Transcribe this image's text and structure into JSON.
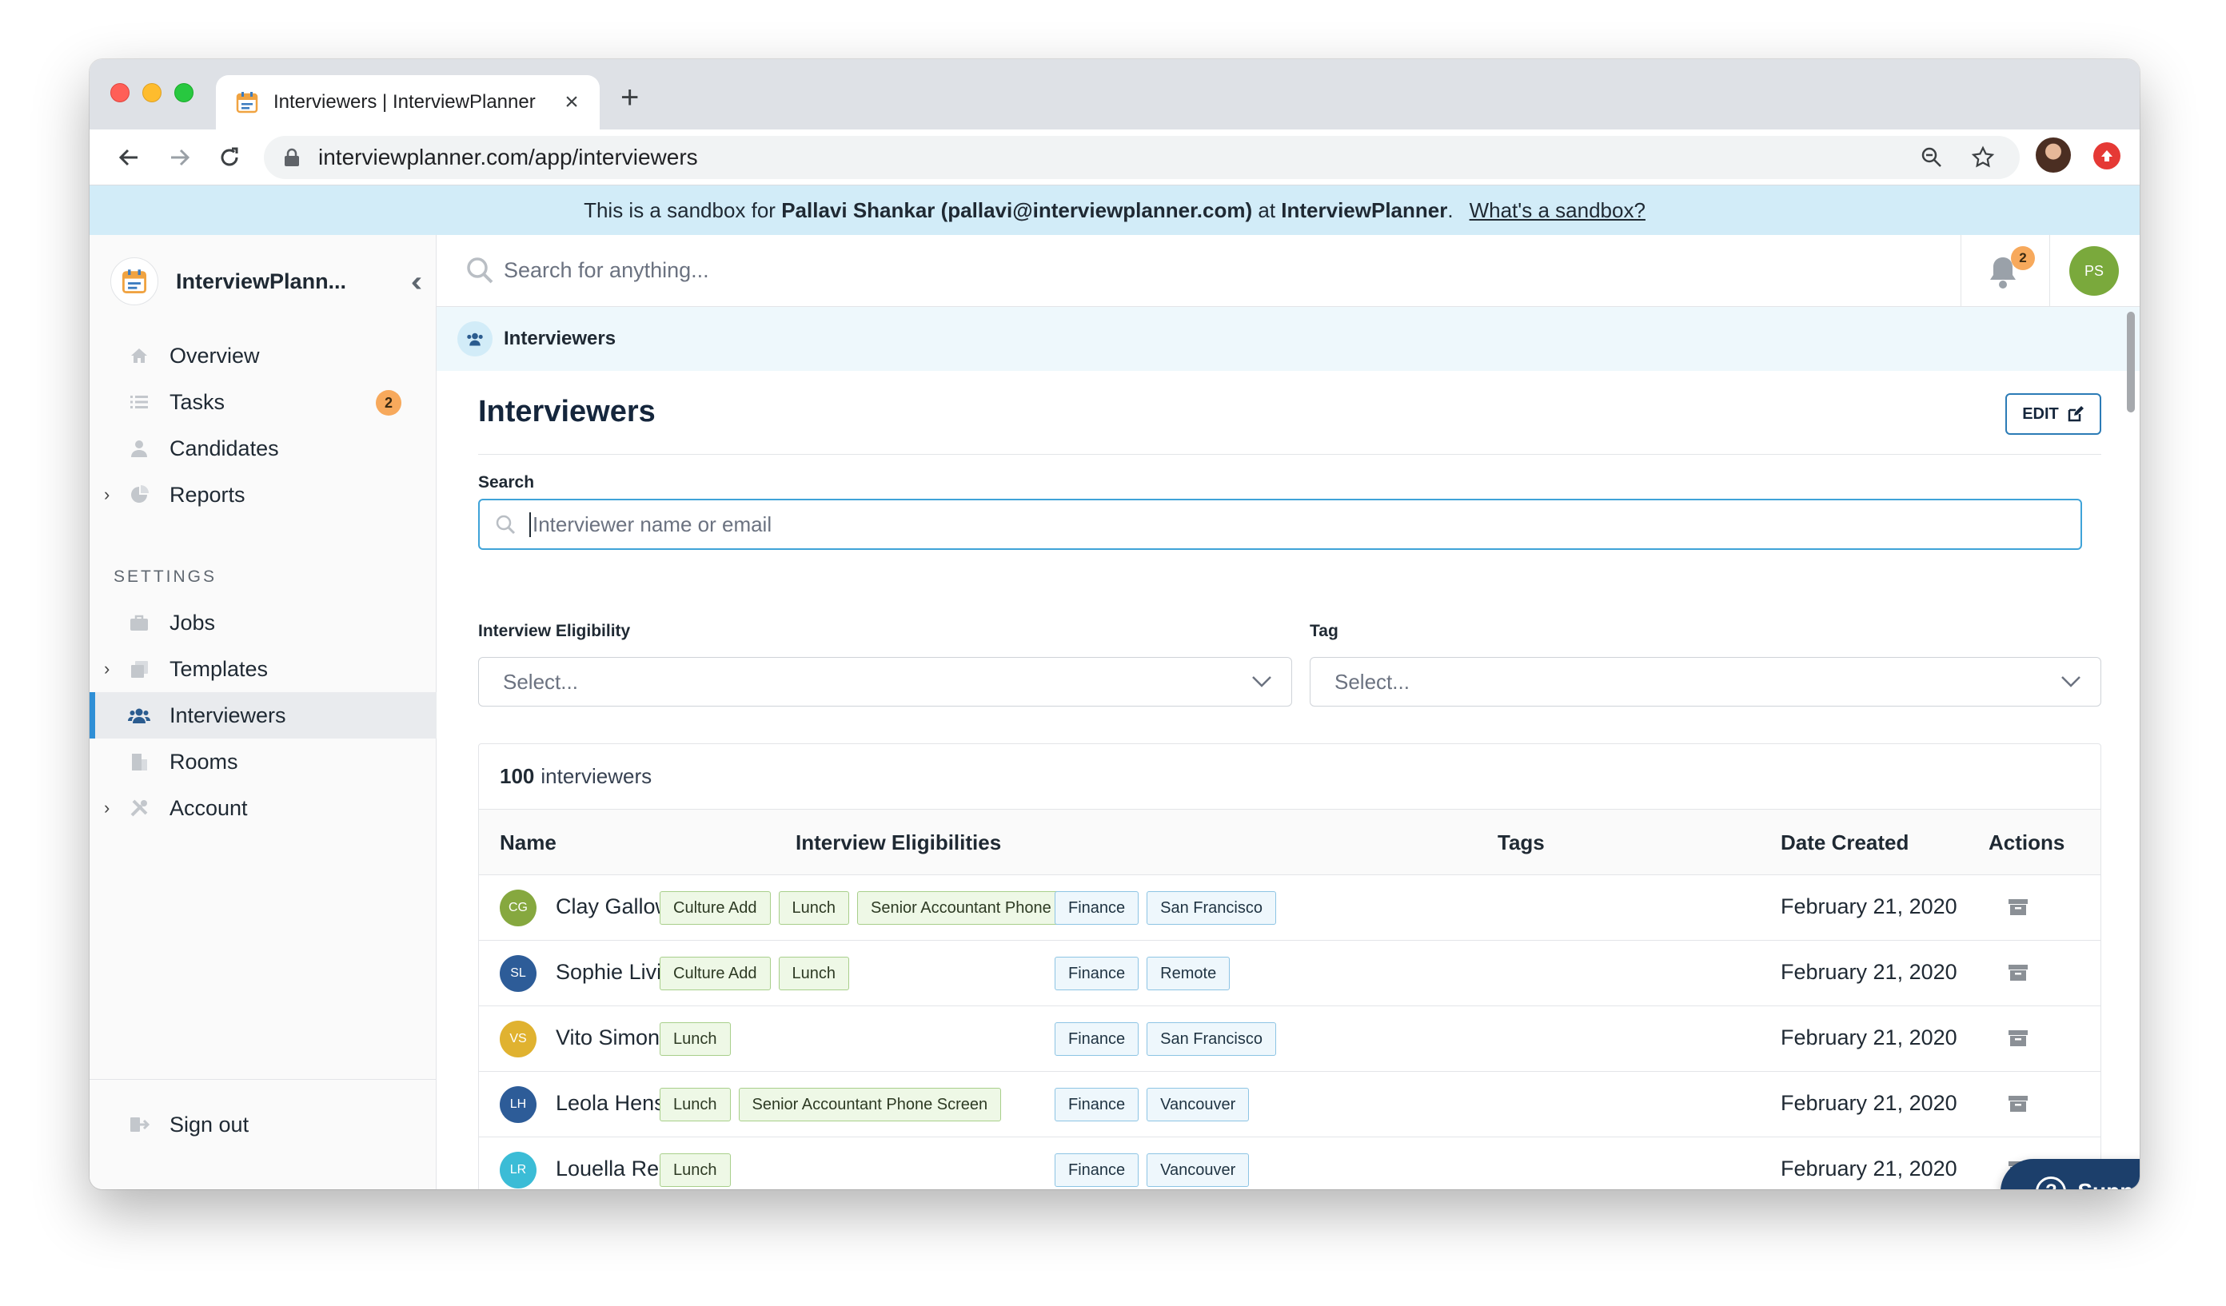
{
  "browser": {
    "tab_title": "Interviewers | InterviewPlanner",
    "url": "interviewplanner.com/app/interviewers"
  },
  "banner": {
    "prefix": "This is a sandbox for",
    "user": "Pallavi Shankar (pallavi@interviewplanner.com)",
    "mid": "at",
    "company": "InterviewPlanner",
    "link": "What's a sandbox?"
  },
  "sidebar": {
    "brand": "InterviewPlann...",
    "items": [
      {
        "label": "Overview",
        "icon": "home-icon"
      },
      {
        "label": "Tasks",
        "icon": "list-icon",
        "badge": "2"
      },
      {
        "label": "Candidates",
        "icon": "person-icon"
      },
      {
        "label": "Reports",
        "icon": "pie-chart-icon",
        "expandable": true
      }
    ],
    "settings_label": "SETTINGS",
    "settings_items": [
      {
        "label": "Jobs",
        "icon": "briefcase-icon"
      },
      {
        "label": "Templates",
        "icon": "copy-icon",
        "expandable": true
      },
      {
        "label": "Interviewers",
        "icon": "users-icon",
        "active": true
      },
      {
        "label": "Rooms",
        "icon": "building-icon"
      },
      {
        "label": "Account",
        "icon": "tools-icon",
        "expandable": true
      }
    ],
    "sign_out": "Sign out"
  },
  "topbar": {
    "search_placeholder": "Search for anything...",
    "notifications": "2",
    "avatar_initials": "PS"
  },
  "breadcrumb": "Interviewers",
  "page": {
    "title": "Interviewers",
    "edit_label": "EDIT",
    "search_label": "Search",
    "search_placeholder": "Interviewer name or email",
    "eligibility_label": "Interview Eligibility",
    "eligibility_value": "Select...",
    "tag_label": "Tag",
    "tag_value": "Select..."
  },
  "table": {
    "count": "100",
    "count_suffix": "interviewers",
    "headers": {
      "name": "Name",
      "eligibilities": "Interview Eligibilities",
      "tags": "Tags",
      "date": "Date Created",
      "actions": "Actions"
    },
    "rows": [
      {
        "initials": "CG",
        "color": "#86a83f",
        "name": "Clay Galloway",
        "eligibilities": [
          "Culture Add",
          "Lunch",
          "Senior Accountant Phone Screen"
        ],
        "tags": [
          "Finance",
          "San Francisco"
        ],
        "date": "February 21, 2020"
      },
      {
        "initials": "SL",
        "color": "#2d5c98",
        "name": "Sophie Livingston",
        "eligibilities": [
          "Culture Add",
          "Lunch"
        ],
        "tags": [
          "Finance",
          "Remote"
        ],
        "date": "February 21, 2020"
      },
      {
        "initials": "VS",
        "color": "#e0b230",
        "name": "Vito Simon",
        "eligibilities": [
          "Lunch"
        ],
        "tags": [
          "Finance",
          "San Francisco"
        ],
        "date": "February 21, 2020"
      },
      {
        "initials": "LH",
        "color": "#2d5c98",
        "name": "Leola Hensley",
        "eligibilities": [
          "Lunch",
          "Senior Accountant Phone Screen"
        ],
        "tags": [
          "Finance",
          "Vancouver"
        ],
        "date": "February 21, 2020"
      },
      {
        "initials": "LR",
        "color": "#3bbcd6",
        "name": "Louella Reid",
        "eligibilities": [
          "Lunch"
        ],
        "tags": [
          "Finance",
          "Vancouver"
        ],
        "date": "February 21, 2020"
      }
    ]
  },
  "support_label": "Support"
}
